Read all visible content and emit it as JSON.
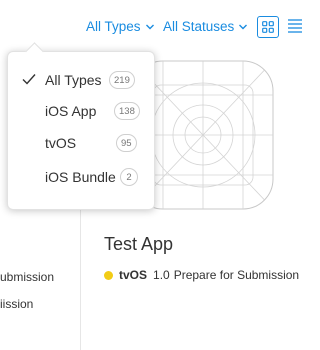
{
  "toolbar": {
    "type_filter": "All Types",
    "status_filter": "All Statuses",
    "accent_color": "#1a8ce0",
    "view_grid_icon": "grid-icon",
    "view_list_icon": "list-icon"
  },
  "left_list": {
    "lines": [
      "ubmission",
      "iission"
    ]
  },
  "app": {
    "name": "Test App",
    "status_color": "#f2cc16",
    "platform": "tvOS",
    "version": "1.0",
    "status": "Prepare for Submission"
  },
  "type_menu": {
    "items": [
      {
        "label": "All Types",
        "count": "219",
        "selected": true
      },
      {
        "label": "iOS App",
        "count": "138",
        "selected": false
      },
      {
        "label": "tvOS",
        "count": "95",
        "selected": false
      },
      {
        "label": "iOS Bundle",
        "count": "2",
        "selected": false
      }
    ]
  }
}
